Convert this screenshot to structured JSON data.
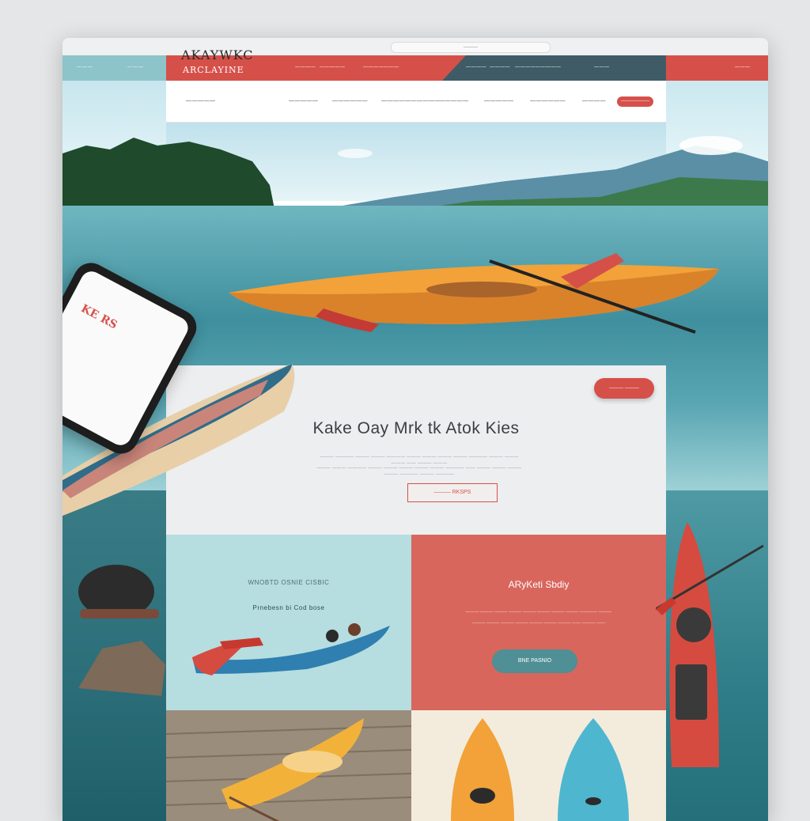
{
  "browser": {
    "url": "———"
  },
  "header": {
    "brand_title": "AKAYWKC",
    "brand_tag": "ARCLAYINE",
    "left_links": [
      "———",
      "———"
    ],
    "top_links": [
      "————",
      "—————",
      "———————",
      "————",
      "————",
      "—————————",
      "———"
    ],
    "right_links": [
      "———"
    ]
  },
  "nav": {
    "items": [
      "—————",
      "—————",
      "——————",
      "——————————",
      "—————",
      "—————",
      "——————",
      "————"
    ],
    "button": "——————"
  },
  "hero": {
    "pill": "——— ———",
    "title": "Kake Oay Mrk tk Atok Kies",
    "text_lines": [
      "——— ———— ——— ——— ———— ——— ——— ——— ——— ———— ——— ——— ——— —— ——— ———",
      "——— ——— ———— ——— ——— ——— ——— ——— ———— —— ——— ——— ——— ——— ———— ——— ————"
    ],
    "cta": "——— RKSPS"
  },
  "panel_blue": {
    "title": "WNOBTD OSNIE CISBIC",
    "subtitle": "Prnebesn bi Cod bose"
  },
  "panel_red": {
    "title": "ARyKeti Sbdiy",
    "text_lines": [
      "——— ——— ——— ——— ——— ——— ——— ——— ———— ———",
      "——— ——— ——— ——— ——— ——— ——— —— ——— ——"
    ],
    "button": "BNE PASNIO"
  },
  "phone": {
    "text": "KE RS"
  },
  "colors": {
    "accent_red": "#d6504a",
    "teal": "#4f8f95",
    "dark_slate": "#3f5c66",
    "light_blue": "#b6dde0",
    "kayak_orange": "#f2a238"
  }
}
